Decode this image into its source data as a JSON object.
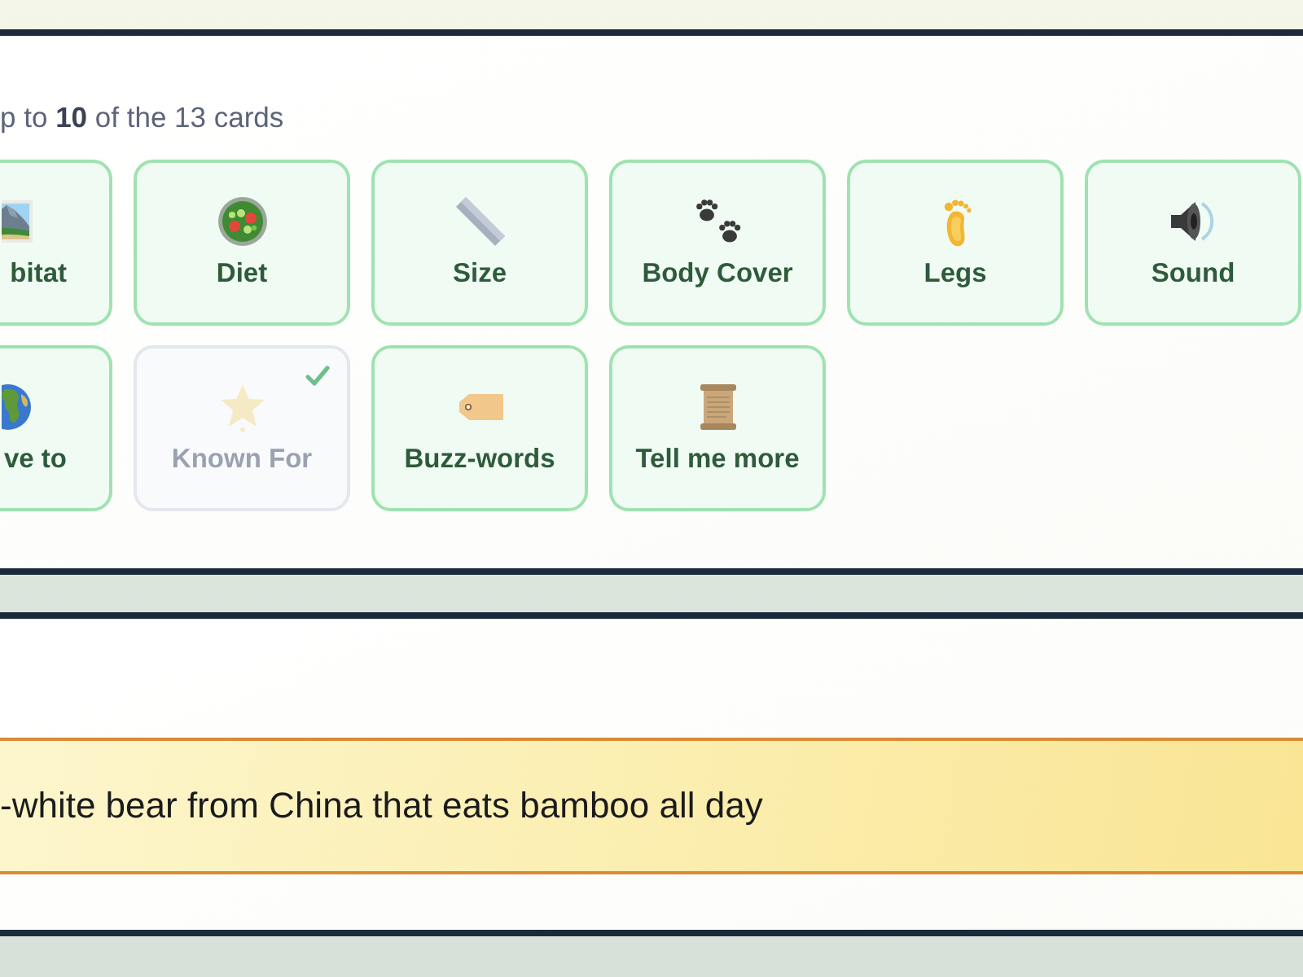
{
  "instruction": "p to **10** of the 13 cards",
  "cards": [
    {
      "label": "bitat",
      "kind": "cut",
      "selected": false
    },
    {
      "label": "Diet",
      "kind": "full",
      "selected": false
    },
    {
      "label": "Size",
      "kind": "full",
      "selected": false
    },
    {
      "label": "Body Cover",
      "kind": "full",
      "selected": false
    },
    {
      "label": "Legs",
      "kind": "full",
      "selected": false
    },
    {
      "label": "Sound",
      "kind": "full",
      "selected": false
    },
    {
      "label": "ve to",
      "kind": "cut",
      "selected": false
    },
    {
      "label": "Known For",
      "kind": "full",
      "selected": true
    },
    {
      "label": "Buzz-words",
      "kind": "full",
      "selected": false
    },
    {
      "label": "Tell me more",
      "kind": "full",
      "selected": false
    }
  ],
  "banner": {
    "text": "-white bear from China that eats bamboo all day"
  }
}
